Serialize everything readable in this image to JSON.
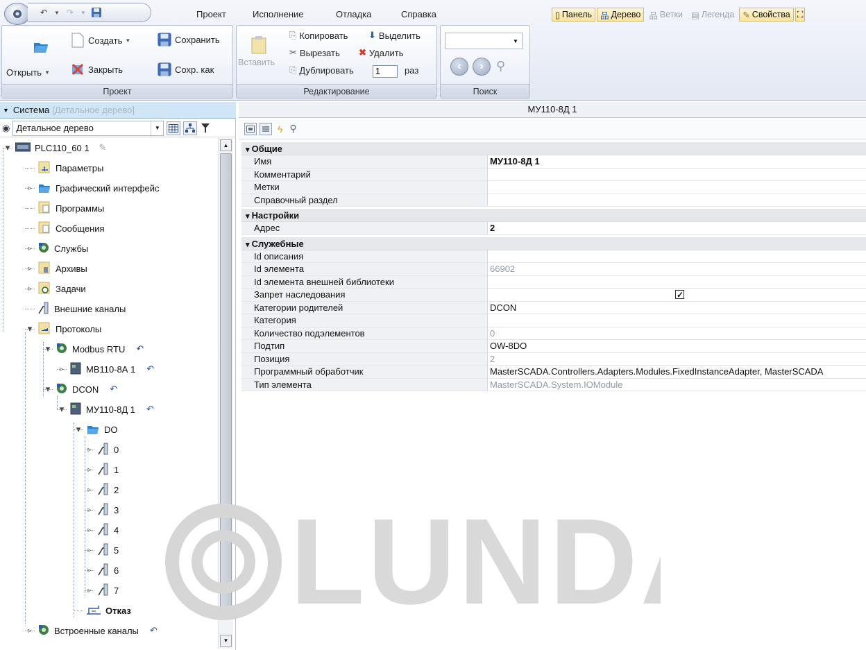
{
  "qat": {
    "icons": [
      "undo-icon",
      "redo-icon",
      "save-icon"
    ]
  },
  "menu": {
    "project": "Проект",
    "execution": "Исполнение",
    "debug": "Отладка",
    "help": "Справка"
  },
  "panel_toggles": [
    {
      "label": "Панель",
      "active": true
    },
    {
      "label": "Дерево",
      "active": true
    },
    {
      "label": "Ветки",
      "active": false
    },
    {
      "label": "Легенда",
      "active": false
    },
    {
      "label": "Свойства",
      "active": true
    }
  ],
  "ribbon": {
    "project_group": {
      "label": "Проект",
      "open": "Открыть",
      "create": "Создать",
      "save": "Сохранить",
      "close": "Закрыть",
      "save_as": "Сохр. как"
    },
    "edit_group": {
      "label": "Редактирование",
      "paste": "Вставить",
      "copy": "Копировать",
      "select": "Выделить",
      "cut": "Вырезать",
      "delete": "Удалить",
      "duplicate": "Дублировать",
      "duplicate_count": "1",
      "times": "раз"
    },
    "search_group": {
      "label": "Поиск",
      "value": ""
    }
  },
  "left": {
    "system_label": "Система",
    "system_hint": "[Детальное дерево]",
    "tree_view": "Детальное дерево",
    "tree": [
      {
        "label": "PLC110_60 1"
      },
      {
        "label": "Параметры"
      },
      {
        "label": "Графический интерфейс"
      },
      {
        "label": "Программы"
      },
      {
        "label": "Сообщения"
      },
      {
        "label": "Службы"
      },
      {
        "label": "Архивы"
      },
      {
        "label": "Задачи"
      },
      {
        "label": "Внешние каналы"
      },
      {
        "label": "Протоколы"
      },
      {
        "label": "Modbus RTU"
      },
      {
        "label": "МВ110-8А 1"
      },
      {
        "label": "DCON"
      },
      {
        "label": "МУ110-8Д 1"
      },
      {
        "label": "DO"
      },
      {
        "label": "0"
      },
      {
        "label": "1"
      },
      {
        "label": "2"
      },
      {
        "label": "3"
      },
      {
        "label": "4"
      },
      {
        "label": "5"
      },
      {
        "label": "6"
      },
      {
        "label": "7"
      },
      {
        "label": "Отказ"
      },
      {
        "label": "Встроенные каналы"
      }
    ]
  },
  "props": {
    "title": "МУ110-8Д 1",
    "categories": [
      {
        "name": "Общие",
        "rows": [
          {
            "name": "Имя",
            "value": "МУ110-8Д 1"
          },
          {
            "name": "Комментарий",
            "value": ""
          },
          {
            "name": "Метки",
            "value": ""
          },
          {
            "name": "Справочный раздел",
            "value": ""
          }
        ]
      },
      {
        "name": "Настройки",
        "rows": [
          {
            "name": "Адрес",
            "value": "2"
          }
        ]
      },
      {
        "name": "Служебные",
        "rows": [
          {
            "name": "Id описания",
            "value": ""
          },
          {
            "name": "Id элемента",
            "value": "66902"
          },
          {
            "name": "Id элемента внешней библиотеки",
            "value": ""
          },
          {
            "name": "Запрет наследования",
            "value": "",
            "checked": true
          },
          {
            "name": "Категории родителей",
            "value": "DCON"
          },
          {
            "name": "Категория",
            "value": ""
          },
          {
            "name": "Количество подэлементов",
            "value": "0"
          },
          {
            "name": "Подтип",
            "value": "OW-8DO"
          },
          {
            "name": "Позиция",
            "value": "2"
          },
          {
            "name": "Программный обработчик",
            "value": "MasterSCADA.Controllers.Adapters.Modules.FixedInstanceAdapter, MasterSCADA"
          },
          {
            "name": "Тип элемента",
            "value": "MasterSCADA.System.IOModule"
          }
        ]
      }
    ]
  },
  "watermark": "LUNDA"
}
